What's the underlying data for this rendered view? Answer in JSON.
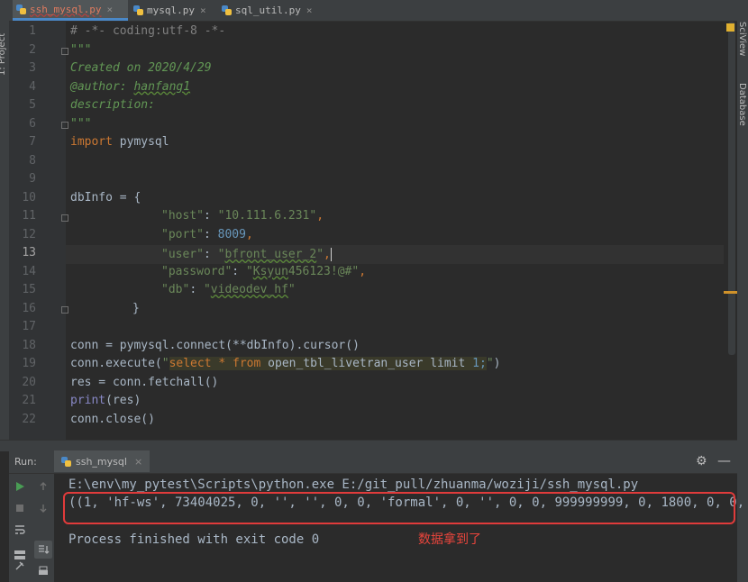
{
  "left_panel": {
    "label": "1: Project"
  },
  "tabs": [
    {
      "label": "ssh_mysql.py",
      "close": "×",
      "active": true
    },
    {
      "label": "mysql.py",
      "close": "×",
      "active": false
    },
    {
      "label": "sql_util.py",
      "close": "×",
      "active": false
    }
  ],
  "right_panels": [
    "SciView",
    "Database"
  ],
  "editor": {
    "line_numbers": [
      "1",
      "2",
      "3",
      "4",
      "5",
      "6",
      "7",
      "8",
      "9",
      "10",
      "11",
      "12",
      "13",
      "14",
      "15",
      "16",
      "17",
      "18",
      "19",
      "20",
      "21",
      "22"
    ],
    "current_line": 13,
    "lines": {
      "l1": "# -*- coding:utf-8 -*-",
      "l2": "\"\"\"",
      "l3": "Created on 2020/4/29",
      "l4a": "@author: ",
      "l4b": "hanfang1",
      "l5": "description:",
      "l6": "\"\"\"",
      "l7a": "import",
      "l7b": " pymysql",
      "l10": "dbInfo = {",
      "l11a": "\"host\"",
      "l11b": ": ",
      "l11c": "\"10.111.6.231\"",
      "l11d": ",",
      "l12a": "\"port\"",
      "l12b": ": ",
      "l12c": "8009",
      "l12d": ",",
      "l13a": "\"user\"",
      "l13b": ": ",
      "l13c": "\"",
      "l13d": "bfront_user_2",
      "l13e": "\"",
      "l13f": ",",
      "l14a": "\"password\"",
      "l14b": ": ",
      "l14c": "\"",
      "l14d": "Ksyun",
      "l14e": "456123!@#\"",
      "l14f": ",",
      "l15a": "\"db\"",
      "l15b": ": ",
      "l15c": "\"",
      "l15d": "videodev_hf",
      "l15e": "\"",
      "l16": "}",
      "l18": "conn = pymysql.connect(**dbInfo).cursor()",
      "l19a": "conn.execute(",
      "l19b": "\"",
      "l19c": "select",
      "l19d": " * ",
      "l19e": "from",
      "l19f": " open_tbl_livetran_user ",
      "l19g": "limit",
      "l19h": " 1;",
      "l19i": "\"",
      "l19j": ")",
      "l20": "res = conn.fetchall()",
      "l21a": "print",
      "l21b": "(res)",
      "l22": "conn.close()"
    }
  },
  "run_panel": {
    "label": "Run:",
    "tab_label": "ssh_mysql",
    "tab_close": "×",
    "gear": "⚙",
    "minimize": "—",
    "buttons": [
      "run-icon",
      "stop-icon",
      "wrap-icon",
      "layout-icon",
      "pin-icon",
      "up-icon",
      "down-icon",
      "scroll-end-icon",
      "print-icon"
    ],
    "console": {
      "command": "E:\\env\\my_pytest\\Scripts\\python.exe E:/git_pull/zhuanma/woziji/ssh_mysql.py",
      "result": "((1, 'hf-ws', 73404025, 0, '', '', 0, 0, 'formal', 0, '', 0, 0, 999999999, 0, 1800, 0, 0,",
      "exit": "Process finished with exit code 0"
    },
    "annotation": "数据拿到了"
  },
  "colors": {
    "accent": "#4a88c7",
    "annotation_red": "#e03b3b"
  }
}
